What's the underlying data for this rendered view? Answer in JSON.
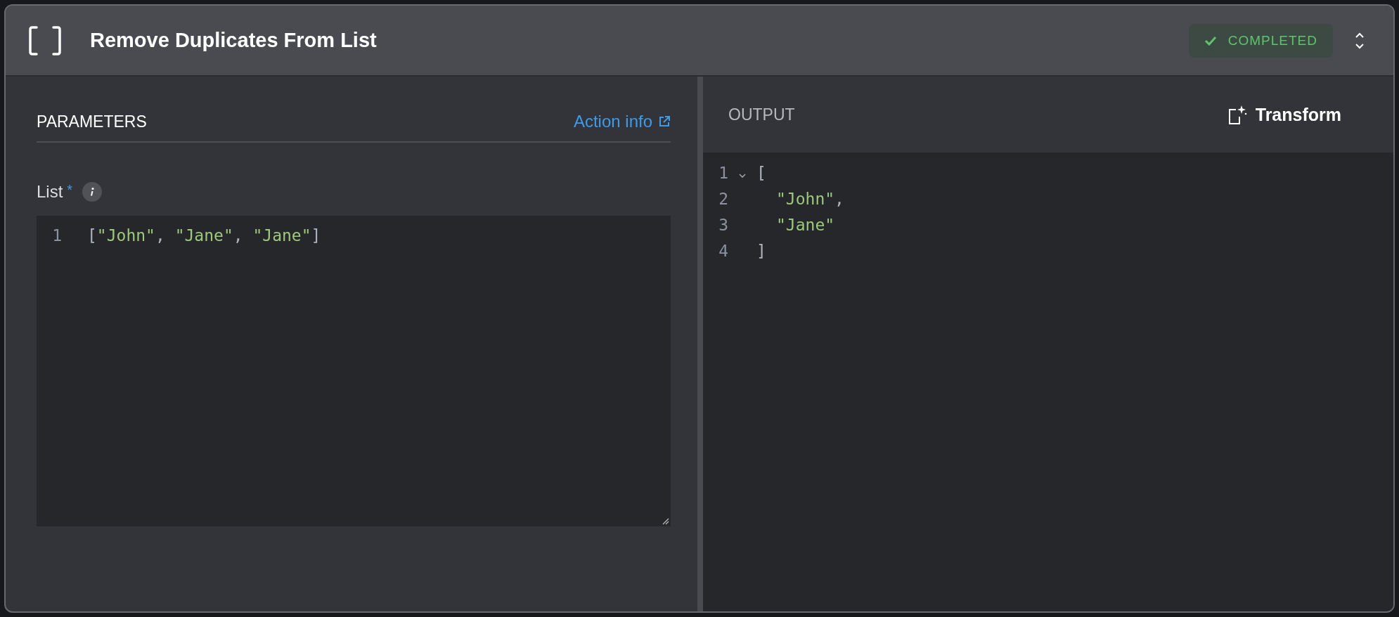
{
  "header": {
    "title": "Remove Duplicates From List",
    "status": {
      "label": "COMPLETED",
      "kind": "success"
    }
  },
  "parameters": {
    "heading": "PARAMETERS",
    "action_link": "Action info",
    "fields": [
      {
        "label": "List",
        "required_mark": "*",
        "lines": [
          {
            "number": "1",
            "tokens": [
              {
                "kind": "punct",
                "text": "["
              },
              {
                "kind": "string",
                "text": "\"John\""
              },
              {
                "kind": "punct",
                "text": ", "
              },
              {
                "kind": "string",
                "text": "\"Jane\""
              },
              {
                "kind": "punct",
                "text": ", "
              },
              {
                "kind": "string",
                "text": "\"Jane\""
              },
              {
                "kind": "punct",
                "text": "]"
              }
            ]
          }
        ]
      }
    ]
  },
  "output": {
    "heading": "OUTPUT",
    "transform_button": "Transform",
    "lines": [
      {
        "number": "1",
        "expanded": true,
        "tokens": [
          {
            "kind": "punct",
            "text": "["
          }
        ],
        "children": [
          {
            "number": "2",
            "tokens": [
              {
                "kind": "string",
                "text": "\"John\""
              },
              {
                "kind": "punct",
                "text": ","
              }
            ]
          },
          {
            "number": "3",
            "tokens": [
              {
                "kind": "string",
                "text": "\"Jane\""
              }
            ]
          }
        ]
      },
      {
        "number": "4",
        "tokens": [
          {
            "kind": "punct",
            "text": "]"
          }
        ]
      }
    ]
  }
}
